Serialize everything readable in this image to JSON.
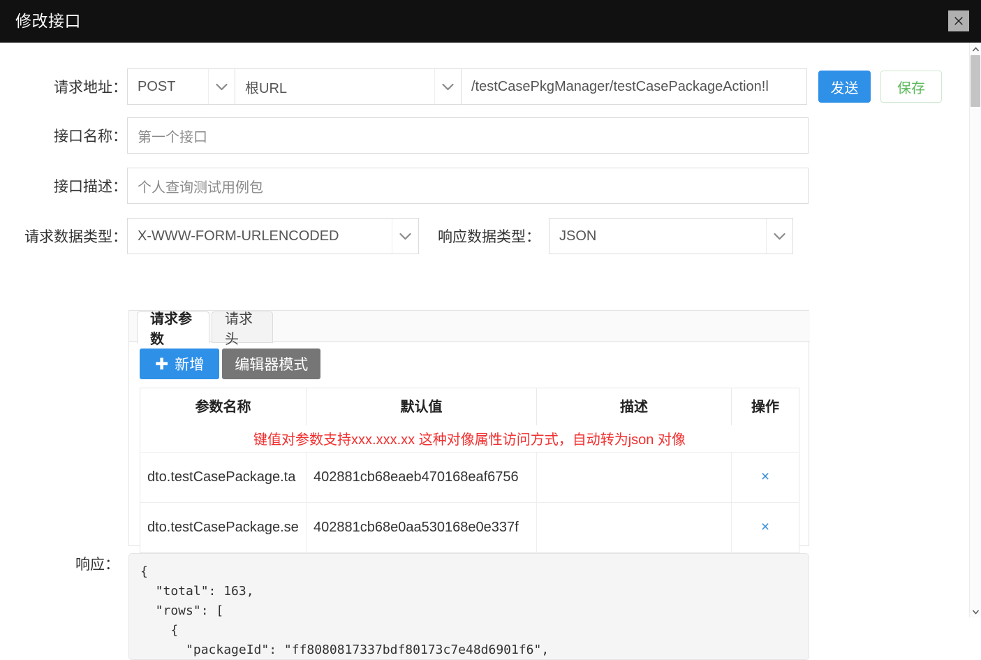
{
  "window": {
    "title": "修改接口",
    "close_icon": "close-icon"
  },
  "form": {
    "url_row": {
      "label": "请求地址：",
      "method": "POST",
      "base_url": "根URL",
      "path": "/testCasePkgManager/testCasePackageAction!l",
      "send_label": "发送",
      "save_label": "保存"
    },
    "name_row": {
      "label": "接口名称：",
      "value": "第一个接口"
    },
    "desc_row": {
      "label": "接口描述：",
      "value": "个人查询测试用例包"
    },
    "request_type_row": {
      "label": "请求数据类型：",
      "value": "X-WWW-FORM-URLENCODED"
    },
    "response_type_row": {
      "label": "响应数据类型：",
      "value": "JSON"
    }
  },
  "tabs": [
    {
      "label": "请求参数",
      "active": true
    },
    {
      "label": "请求头",
      "active": false
    }
  ],
  "toolbar": {
    "add_label": "新增",
    "add_icon": "plus-icon",
    "editor_mode_label": "编辑器模式"
  },
  "params_table": {
    "headers": [
      "参数名称",
      "默认值",
      "描述",
      "操作"
    ],
    "note": "键值对参数支持xxx.xxx.xx 这种对像属性访问方式，自动转为json 对像",
    "note_color": "#f22f2f",
    "rows": [
      {
        "name": "dto.testCasePackage.ta",
        "value": "402881cb68eaeb470168eaf6756",
        "description": "",
        "delete_label": "×"
      },
      {
        "name": "dto.testCasePackage.se",
        "value": "402881cb68e0aa530168e0e337f",
        "description": "",
        "delete_label": "×"
      }
    ]
  },
  "response": {
    "label": "响应：",
    "body": "{\n  \"total\": 163,\n  \"rows\": [\n    {\n      \"packageId\": \"ff8080817337bdf80173c7e48d6901f6\","
  },
  "colors": {
    "titlebar_bg": "#111111",
    "primary_blue": "#2f90e8",
    "save_green": "#5cb85c",
    "editor_gray": "#767676",
    "note_red": "#f22f2f",
    "delete_blue": "#3a8fd8"
  },
  "scrollbar": {
    "up_arrow_icon": "chevron-up-icon",
    "down_arrow_icon": "chevron-down-icon"
  }
}
